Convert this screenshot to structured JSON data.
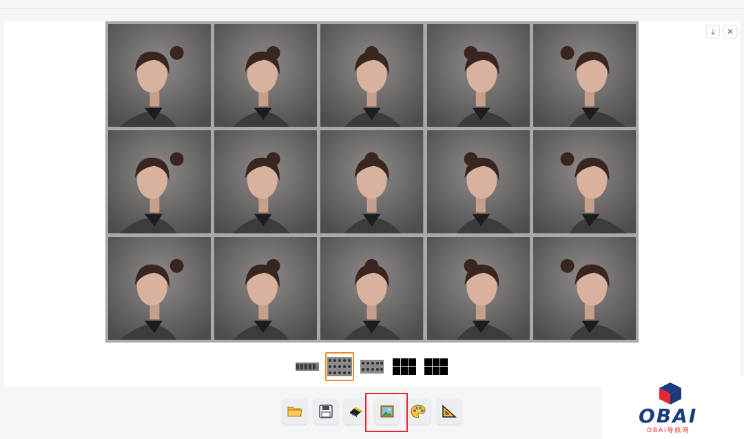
{
  "viewer": {
    "grid_rows": 3,
    "grid_cols": 5,
    "image_alt": "character portrait turnaround grid"
  },
  "corner_actions": {
    "download_symbol": "⤓",
    "close_symbol": "✕"
  },
  "thumbnails": [
    {
      "name": "thumb-strip",
      "selected": false
    },
    {
      "name": "thumb-grid-3x5",
      "selected": true
    },
    {
      "name": "thumb-grid-small",
      "selected": false
    },
    {
      "name": "thumb-black-dots",
      "selected": false
    },
    {
      "name": "thumb-black-grid",
      "selected": false
    }
  ],
  "toolbar": {
    "items": [
      {
        "icon": "folder-open-icon"
      },
      {
        "icon": "floppy-disk-icon"
      },
      {
        "icon": "eraser-icon"
      },
      {
        "icon": "picture-icon"
      },
      {
        "icon": "palette-icon"
      },
      {
        "icon": "triangle-ruler-icon"
      }
    ],
    "highlighted_index": 3
  },
  "logo": {
    "text": "OBAI",
    "subtitle": "OBAI导航网"
  },
  "colors": {
    "accent_selected": "#f08a24",
    "highlight_box": "#e4292e",
    "logo_blue": "#1a3b7e",
    "logo_red": "#e4292e"
  }
}
